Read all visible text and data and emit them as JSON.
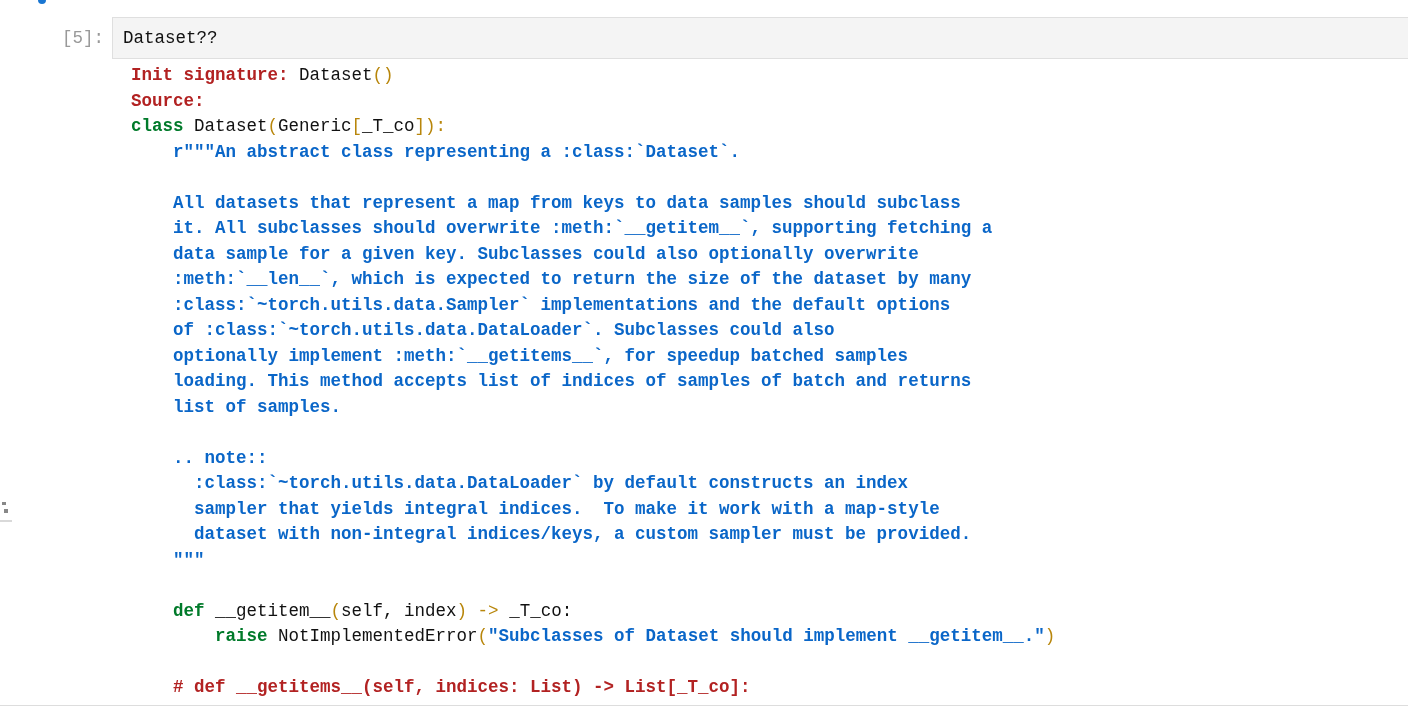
{
  "input_cell": {
    "prompt": "[5]:",
    "source": "Dataset??"
  },
  "output": {
    "lines": [
      {
        "kind": "code",
        "tokens": [
          {
            "kind": "label",
            "text": "Init signature:"
          },
          {
            "kind": "plain",
            "text": " Dataset"
          },
          {
            "kind": "paren",
            "text": "()"
          }
        ]
      },
      {
        "kind": "code",
        "tokens": [
          {
            "kind": "label",
            "text": "Source:"
          }
        ]
      },
      {
        "kind": "code",
        "tokens": [
          {
            "kind": "keyword",
            "text": "class"
          },
          {
            "kind": "plain",
            "text": " Dataset"
          },
          {
            "kind": "paren",
            "text": "("
          },
          {
            "kind": "plain",
            "text": "Generic"
          },
          {
            "kind": "paren",
            "text": "["
          },
          {
            "kind": "plain",
            "text": "_T_co"
          },
          {
            "kind": "paren",
            "text": "]):"
          }
        ]
      },
      {
        "kind": "code",
        "tokens": [
          {
            "kind": "string",
            "text": "    r\"\"\"An abstract class representing a :class:`Dataset`."
          }
        ]
      },
      {
        "kind": "blank"
      },
      {
        "kind": "code",
        "tokens": [
          {
            "kind": "string",
            "text": "    All datasets that represent a map from keys to data samples should subclass"
          }
        ]
      },
      {
        "kind": "code",
        "tokens": [
          {
            "kind": "string",
            "text": "    it. All subclasses should overwrite :meth:`__getitem__`, supporting fetching a"
          }
        ]
      },
      {
        "kind": "code",
        "tokens": [
          {
            "kind": "string",
            "text": "    data sample for a given key. Subclasses could also optionally overwrite"
          }
        ]
      },
      {
        "kind": "code",
        "tokens": [
          {
            "kind": "string",
            "text": "    :meth:`__len__`, which is expected to return the size of the dataset by many"
          }
        ]
      },
      {
        "kind": "code",
        "tokens": [
          {
            "kind": "string",
            "text": "    :class:`~torch.utils.data.Sampler` implementations and the default options"
          }
        ]
      },
      {
        "kind": "code",
        "tokens": [
          {
            "kind": "string",
            "text": "    of :class:`~torch.utils.data.DataLoader`. Subclasses could also"
          }
        ]
      },
      {
        "kind": "code",
        "tokens": [
          {
            "kind": "string",
            "text": "    optionally implement :meth:`__getitems__`, for speedup batched samples"
          }
        ]
      },
      {
        "kind": "code",
        "tokens": [
          {
            "kind": "string",
            "text": "    loading. This method accepts list of indices of samples of batch and returns"
          }
        ]
      },
      {
        "kind": "code",
        "tokens": [
          {
            "kind": "string",
            "text": "    list of samples."
          }
        ]
      },
      {
        "kind": "blank"
      },
      {
        "kind": "code",
        "tokens": [
          {
            "kind": "string",
            "text": "    .. note::"
          }
        ]
      },
      {
        "kind": "code",
        "tokens": [
          {
            "kind": "string",
            "text": "      :class:`~torch.utils.data.DataLoader` by default constructs an index"
          }
        ]
      },
      {
        "kind": "code",
        "tokens": [
          {
            "kind": "string",
            "text": "      sampler that yields integral indices.  To make it work with a map-style"
          }
        ]
      },
      {
        "kind": "code",
        "tokens": [
          {
            "kind": "string",
            "text": "      dataset with non-integral indices/keys, a custom sampler must be provided."
          }
        ]
      },
      {
        "kind": "code",
        "tokens": [
          {
            "kind": "string",
            "text": "    \"\"\""
          }
        ]
      },
      {
        "kind": "blank"
      },
      {
        "kind": "code",
        "tokens": [
          {
            "kind": "keyword",
            "text": "    def"
          },
          {
            "kind": "plain",
            "text": " __getitem__"
          },
          {
            "kind": "paren",
            "text": "("
          },
          {
            "kind": "plain",
            "text": "self, index"
          },
          {
            "kind": "paren",
            "text": ")"
          },
          {
            "kind": "paren",
            "text": " ->"
          },
          {
            "kind": "plain",
            "text": " _T_co:"
          }
        ]
      },
      {
        "kind": "code",
        "tokens": [
          {
            "kind": "keyword",
            "text": "        raise"
          },
          {
            "kind": "plain",
            "text": " NotImplementedError"
          },
          {
            "kind": "paren",
            "text": "("
          },
          {
            "kind": "string",
            "text": "\"Subclasses of Dataset should implement __getitem__.\""
          },
          {
            "kind": "paren",
            "text": ")"
          }
        ]
      },
      {
        "kind": "blank"
      },
      {
        "kind": "code",
        "tokens": [
          {
            "kind": "comment",
            "text": "    # def __getitems__(self, indices: List) -> List[_T_co]:"
          }
        ]
      }
    ]
  }
}
